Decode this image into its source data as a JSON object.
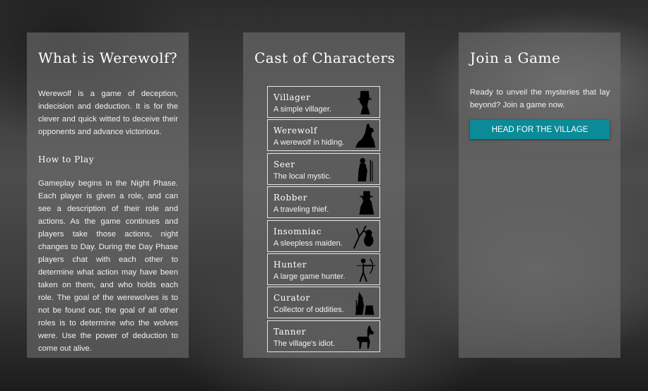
{
  "about": {
    "title": "What is Werewolf?",
    "intro": "Werewolf is a game of deception, indecision and deduction. It is for the clever and quick witted to deceive their opponents and advance victorious.",
    "how_to_play_heading": "How to Play",
    "how_to_play": "Gameplay begins in the Night Phase. Each player is given a role, and can see a description of their role and actions. As the game continues and players take those actions, night changes to Day. During the Day Phase players chat with each other to determine what action may have been taken on them, and who holds each role. The goal of the werewolves is to not be found out; the goal of all other roles is to determine who the wolves were. Use the power of deduction to come out alive."
  },
  "cast": {
    "title": "Cast of Characters",
    "characters": [
      {
        "name": "Villager",
        "description": "A simple villager.",
        "icon": "villager-icon"
      },
      {
        "name": "Werewolf",
        "description": "A werewolf in hiding.",
        "icon": "werewolf-icon"
      },
      {
        "name": "Seer",
        "description": "The local mystic.",
        "icon": "seer-icon"
      },
      {
        "name": "Robber",
        "description": "A traveling thief.",
        "icon": "robber-icon"
      },
      {
        "name": "Insomniac",
        "description": "A sleepless maiden.",
        "icon": "insomniac-icon"
      },
      {
        "name": "Hunter",
        "description": "A large game hunter.",
        "icon": "hunter-icon"
      },
      {
        "name": "Curator",
        "description": "Collector of oddities.",
        "icon": "curator-icon"
      },
      {
        "name": "Tanner",
        "description": "The village's idiot.",
        "icon": "tanner-icon"
      }
    ]
  },
  "join": {
    "title": "Join a Game",
    "text": "Ready to unveil the mysteries that lay beyond? Join a game now.",
    "button_label": "HEAD FOR THE VILLAGE",
    "button_color": "#0b8a98"
  }
}
